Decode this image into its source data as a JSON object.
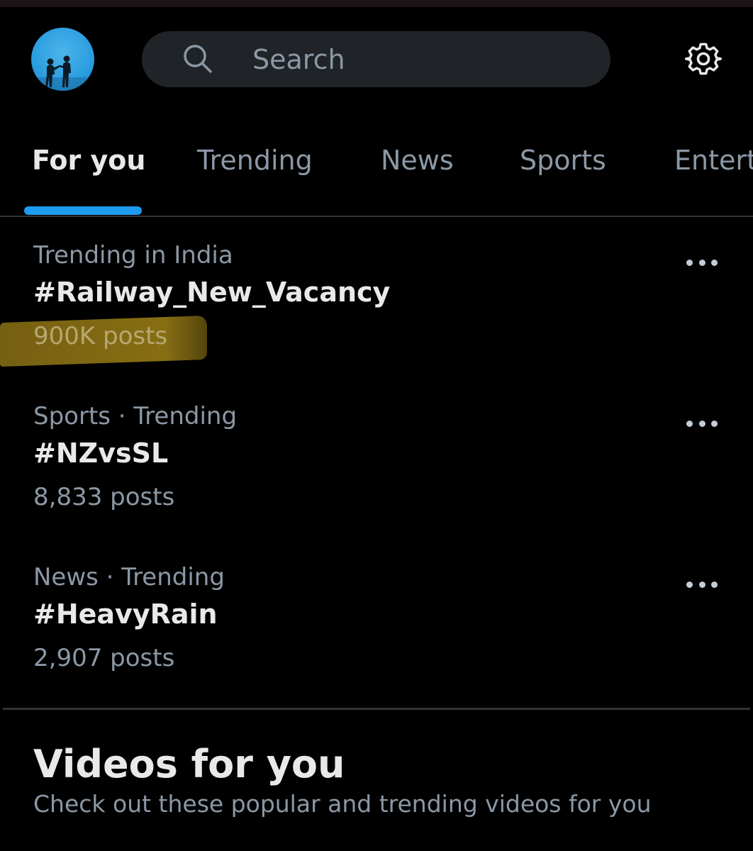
{
  "header": {
    "search": {
      "placeholder": "Search"
    }
  },
  "tabs": [
    {
      "label": "For you",
      "active": true
    },
    {
      "label": "Trending",
      "active": false
    },
    {
      "label": "News",
      "active": false
    },
    {
      "label": "Sports",
      "active": false
    },
    {
      "label": "Entert",
      "active": false
    }
  ],
  "trends": [
    {
      "context": "Trending in India",
      "title": "#Railway_New_Vacancy",
      "count": "900K posts"
    },
    {
      "context": "Sports · Trending",
      "title": "#NZvsSL",
      "count": "8,833 posts"
    },
    {
      "context": "News · Trending",
      "title": "#HeavyRain",
      "count": "2,907 posts"
    }
  ],
  "videos_section": {
    "heading": "Videos for you",
    "subtitle": "Check out these popular and trending videos for you"
  },
  "colors": {
    "background": "#000000",
    "accent": "#1d9bf0",
    "primary_text": "#e7e9ea",
    "secondary_text": "#8b98a5",
    "search_background": "#202327",
    "divider": "#2f3336",
    "highlight_marker": "#967a16"
  },
  "icons": {
    "search": "search-icon",
    "settings": "gear-icon",
    "more": "more-horizontal-icon"
  }
}
